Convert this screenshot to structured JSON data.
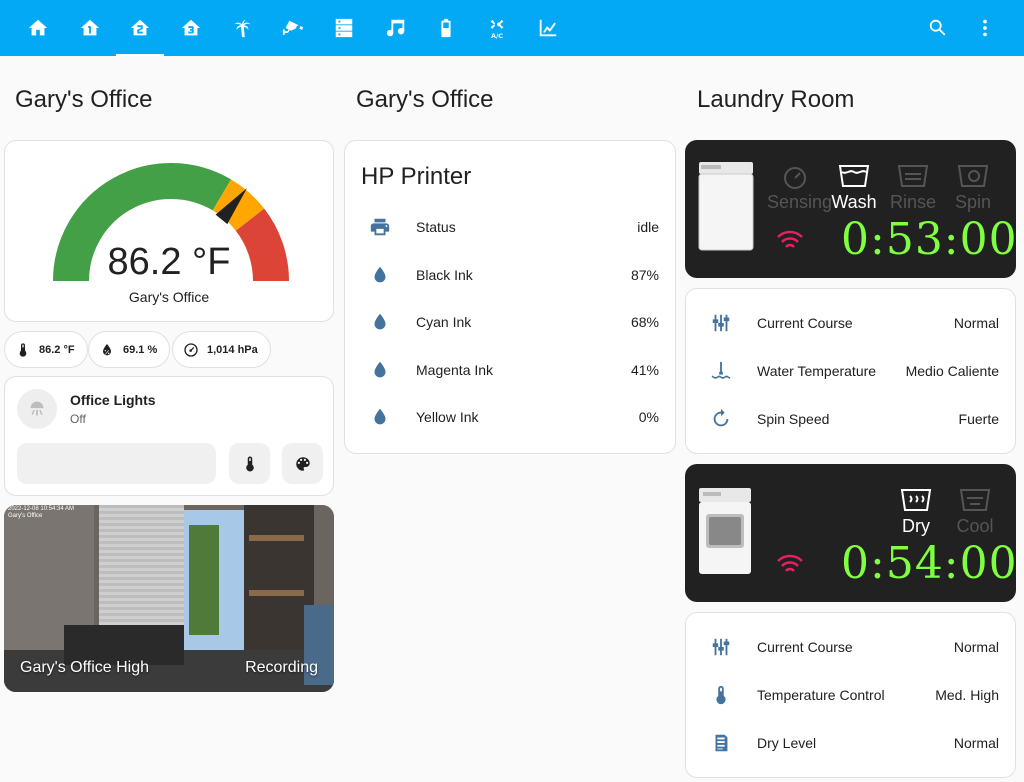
{
  "toolbar": {
    "tabs": [
      {
        "icon": "home-icon"
      },
      {
        "icon": "home-floor-1-icon"
      },
      {
        "icon": "home-floor-2-icon",
        "active": true
      },
      {
        "icon": "home-floor-3-icon"
      },
      {
        "icon": "palm-tree-icon"
      },
      {
        "icon": "cctv-icon"
      },
      {
        "icon": "server-icon"
      },
      {
        "icon": "music-icon"
      },
      {
        "icon": "battery-icon"
      },
      {
        "icon": "air-conditioner-icon",
        "sub": "A/C"
      },
      {
        "icon": "chart-line-icon"
      }
    ],
    "search_icon": "magnify-icon",
    "menu_icon": "dots-vertical-icon",
    "color": "#03a9f4"
  },
  "col1": {
    "title": "Gary's Office",
    "gauge": {
      "value": "86.2 °F",
      "name": "Gary's Office",
      "level": 86.2,
      "min": 0,
      "max": 120,
      "segments": [
        {
          "color": "#43a047"
        },
        {
          "color": "#ffa600"
        },
        {
          "color": "#db4437"
        }
      ]
    },
    "badges": [
      {
        "icon": "thermometer-icon",
        "text": "86.2 °F"
      },
      {
        "icon": "water-percent-icon",
        "text": "69.1 %"
      },
      {
        "icon": "gauge-icon",
        "text": "1,014 hPa"
      }
    ],
    "light": {
      "name": "Office Lights",
      "state": "Off"
    },
    "camera": {
      "name": "Gary's Office High",
      "status": "Recording",
      "overlay": "2022-12-08 10:54:34 AM",
      "overlay2": "Gary's Office"
    }
  },
  "col2": {
    "title": "Gary's Office",
    "card_title": "HP Printer",
    "rows": [
      {
        "icon": "printer-icon",
        "label": "Status",
        "value": "idle"
      },
      {
        "icon": "water-icon",
        "label": "Black Ink",
        "value": "87%"
      },
      {
        "icon": "water-icon",
        "label": "Cyan Ink",
        "value": "68%"
      },
      {
        "icon": "water-icon",
        "label": "Magenta Ink",
        "value": "41%"
      },
      {
        "icon": "water-icon",
        "label": "Yellow Ink",
        "value": "0%"
      }
    ]
  },
  "col3": {
    "title": "Laundry Room",
    "washer": {
      "stages": [
        {
          "label": "Sensing",
          "active": false
        },
        {
          "label": "Wash",
          "active": true
        },
        {
          "label": "Rinse",
          "active": false
        },
        {
          "label": "Spin",
          "active": false
        }
      ],
      "timer": "0:53:00",
      "rows": [
        {
          "icon": "tune-vertical-icon",
          "label": "Current Course",
          "value": "Normal"
        },
        {
          "icon": "water-thermometer-icon",
          "label": "Water Temperature",
          "value": "Medio Caliente"
        },
        {
          "icon": "rotate-icon",
          "label": "Spin Speed",
          "value": "Fuerte"
        }
      ]
    },
    "dryer": {
      "stages": [
        {
          "label": "Dry",
          "active": true
        },
        {
          "label": "Cool",
          "active": false
        }
      ],
      "timer": "0:54:00",
      "rows": [
        {
          "icon": "tune-vertical-icon",
          "label": "Current Course",
          "value": "Normal"
        },
        {
          "icon": "thermometer-icon",
          "label": "Temperature Control",
          "value": "Med. High"
        },
        {
          "icon": "dry-level-icon",
          "label": "Dry Level",
          "value": "Normal"
        }
      ]
    },
    "wifi_color": "#e91e63",
    "timer_color": "#7fff3f"
  }
}
